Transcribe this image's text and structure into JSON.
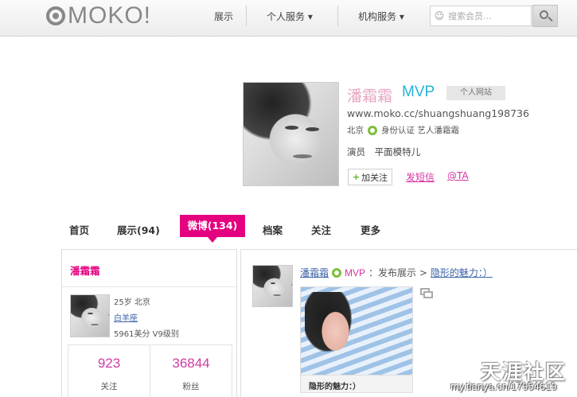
{
  "nav": {
    "logo": "MOKO!",
    "items": [
      "展示",
      "个人服务 ▾",
      "机构服务 ▾"
    ],
    "search_placeholder": "搜索会员..."
  },
  "profile": {
    "name": "潘霜霜",
    "badge": "MVP",
    "site_button": "个人网站",
    "url": "www.moko.cc/shuangshuang198736",
    "city": "北京",
    "verify_text": "身份认证 艺人潘霜霜",
    "job": "演员 平面模特儿",
    "follow_label": "加关注",
    "message_link": "发短信",
    "at_link": "@TA"
  },
  "tabs": {
    "items": [
      "首页",
      "展示(94)",
      "档案",
      "关注",
      "更多"
    ],
    "active": "微博(134)"
  },
  "left_card": {
    "name": "潘霜霜",
    "age_city": "25岁 北京",
    "constellation": "白羊座",
    "points": "5961美分 V9级别",
    "stats": [
      {
        "num": "923",
        "label": "关注"
      },
      {
        "num": "36844",
        "label": "粉丝"
      }
    ]
  },
  "post": {
    "author": "潘霜霜",
    "vip": "MVP",
    "action": "：发布展示 >",
    "title": "隐形的魅力：）",
    "caption": "隐形的魅力：）"
  },
  "watermark": {
    "title": "天涯社区",
    "url": "my.tianya.cn/17954619"
  },
  "colors": {
    "accent": "#e4007f",
    "link_blue": "#3b64a8",
    "mvp_blue": "#27b3d6"
  }
}
